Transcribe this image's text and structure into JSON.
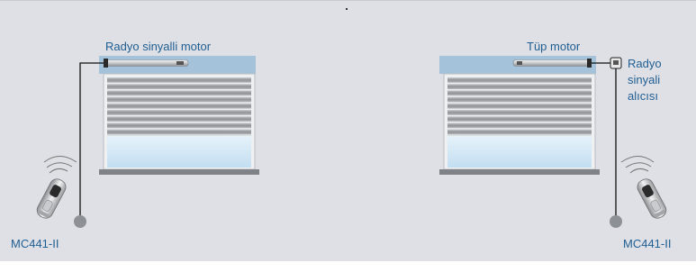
{
  "left": {
    "motor_label": "Radyo sinyalli motor",
    "remote_label": "MC441-II"
  },
  "right": {
    "motor_label": "Tüp motor",
    "receiver_label_line1": "Radyo",
    "receiver_label_line2": "sinyali",
    "receiver_label_line3": "alıcısı",
    "remote_label": "MC441-II"
  },
  "colors": {
    "background": "#dfe0e6",
    "label_text": "#1f5e92",
    "shutter_box": "#a4c3da",
    "window_glass": "#cfe6f6",
    "slat_dark": "#9ea1a5",
    "wire": "#111111"
  }
}
